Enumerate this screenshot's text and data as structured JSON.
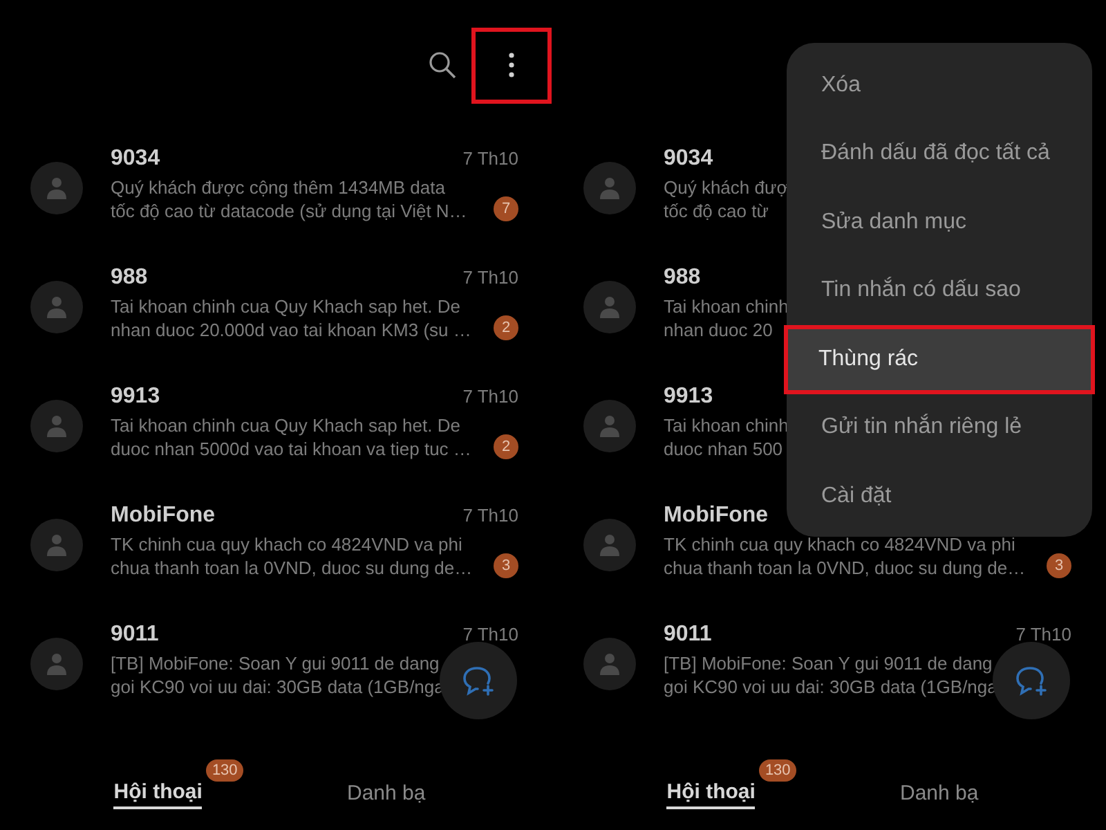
{
  "panels": [
    {
      "toolbar": {
        "more_highlighted": true
      },
      "conversations": [
        {
          "name": "9034",
          "date": "7 Th10",
          "preview_lines": [
            "Quý khách được cộng thêm 1434MB data",
            "tốc độ cao từ datacode (sử dụng tại Việt N…"
          ],
          "unread": "7"
        },
        {
          "name": "988",
          "date": "7 Th10",
          "preview_lines": [
            "Tai khoan chinh cua Quy Khach sap het. De",
            "nhan duoc 20.000d vao tai khoan KM3 (su …"
          ],
          "unread": "2"
        },
        {
          "name": "9913",
          "date": "7 Th10",
          "preview_lines": [
            "Tai khoan chinh cua Quy Khach sap het. De",
            "duoc nhan 5000d vao tai khoan va tiep tuc …"
          ],
          "unread": "2"
        },
        {
          "name": "MobiFone",
          "date": "7 Th10",
          "preview_lines": [
            "TK chinh cua quy khach co 4824VND va phi",
            "chua thanh toan la 0VND, duoc su dung de…"
          ],
          "unread": "3"
        },
        {
          "name": "9011",
          "date": "7 Th10",
          "preview_lines": [
            "[TB] MobiFone: Soan Y gui 9011 de dang",
            "goi KC90 voi uu dai: 30GB data (1GB/nga"
          ]
        }
      ],
      "tabs": [
        {
          "label": "Hội thoại",
          "selected": true,
          "badge": "130"
        },
        {
          "label": "Danh bạ",
          "selected": false
        }
      ]
    },
    {
      "menu": {
        "items": [
          {
            "label": "Xóa",
            "selected": false
          },
          {
            "label": "Đánh dấu đã đọc tất cả",
            "selected": false
          },
          {
            "label": "Sửa danh mục",
            "selected": false
          },
          {
            "label": "Tin nhắn có dấu sao",
            "selected": false
          },
          {
            "label": "Thùng rác",
            "selected": true
          },
          {
            "label": "Gửi tin nhắn riêng lẻ",
            "selected": false
          },
          {
            "label": "Cài đặt",
            "selected": false
          }
        ]
      },
      "conversations": [
        {
          "name": "9034",
          "preview_lines": [
            "Quý khách đượ",
            "tốc độ cao từ"
          ]
        },
        {
          "name": "988",
          "preview_lines": [
            "Tai khoan chinh",
            "nhan duoc 20"
          ]
        },
        {
          "name": "9913",
          "preview_lines": [
            "Tai khoan chinh",
            "duoc nhan 500"
          ]
        },
        {
          "name": "MobiFone",
          "preview_lines": [
            "TK chinh cua quy khach co 4824VND va phi",
            "chua thanh toan la 0VND, duoc su dung de…"
          ],
          "unread": "3"
        },
        {
          "name": "9011",
          "date": "7 Th10",
          "preview_lines": [
            "[TB] MobiFone: Soan Y gui 9011 de dang",
            "goi KC90 voi uu dai: 30GB data (1GB/nga"
          ]
        }
      ],
      "tabs": [
        {
          "label": "Hội thoại",
          "selected": true,
          "badge": "130"
        },
        {
          "label": "Danh bạ",
          "selected": false
        }
      ]
    }
  ]
}
